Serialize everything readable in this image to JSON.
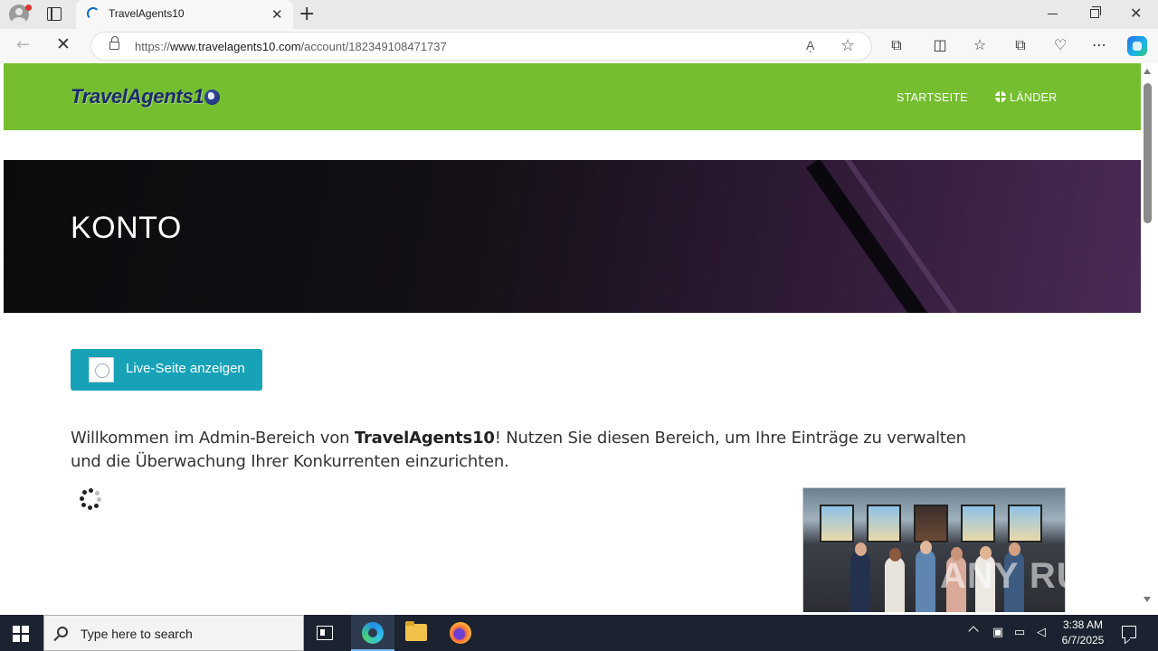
{
  "browser": {
    "tab_title": "TravelAgents10",
    "tab_close": "✕",
    "new_tab": "+",
    "url_prefix": "https://",
    "url_host": "www.travelagents10.com",
    "url_path": "/account/182349108471737",
    "read_aloud": "Aͅ",
    "favorite_star": "☆",
    "back_arrow": "←",
    "stop_icon": "✕",
    "window_close": "✕",
    "toolbar_icons": {
      "extensions": "⧉",
      "split_screen": "◫",
      "favorites": "☆",
      "collections": "⧉",
      "performance": "♡",
      "more": "⋯"
    }
  },
  "site": {
    "logo_text": "TravelAgents1",
    "nav": {
      "home": "STARTSEITE",
      "countries": "LÄNDER"
    },
    "hero_title": "KONTO",
    "live_button": "Live-Seite anzeigen",
    "welcome": {
      "before": "Willkommen im Admin-Bereich von ",
      "brand": "TravelAgents10",
      "after": "! Nutzen Sie diesen Bereich, um Ihre Einträge zu verwalten und die Überwachung Ihrer Konkurrenten einzurichten."
    },
    "watermark": "ANY RUN"
  },
  "taskbar": {
    "search_placeholder": "Type here to search",
    "time": "3:38 AM",
    "date": "6/7/2025"
  },
  "colors": {
    "header_green": "#74be2f",
    "logo_navy": "#1c2a6e",
    "button_teal": "#17a2b8",
    "taskbar": "#1c2330"
  }
}
